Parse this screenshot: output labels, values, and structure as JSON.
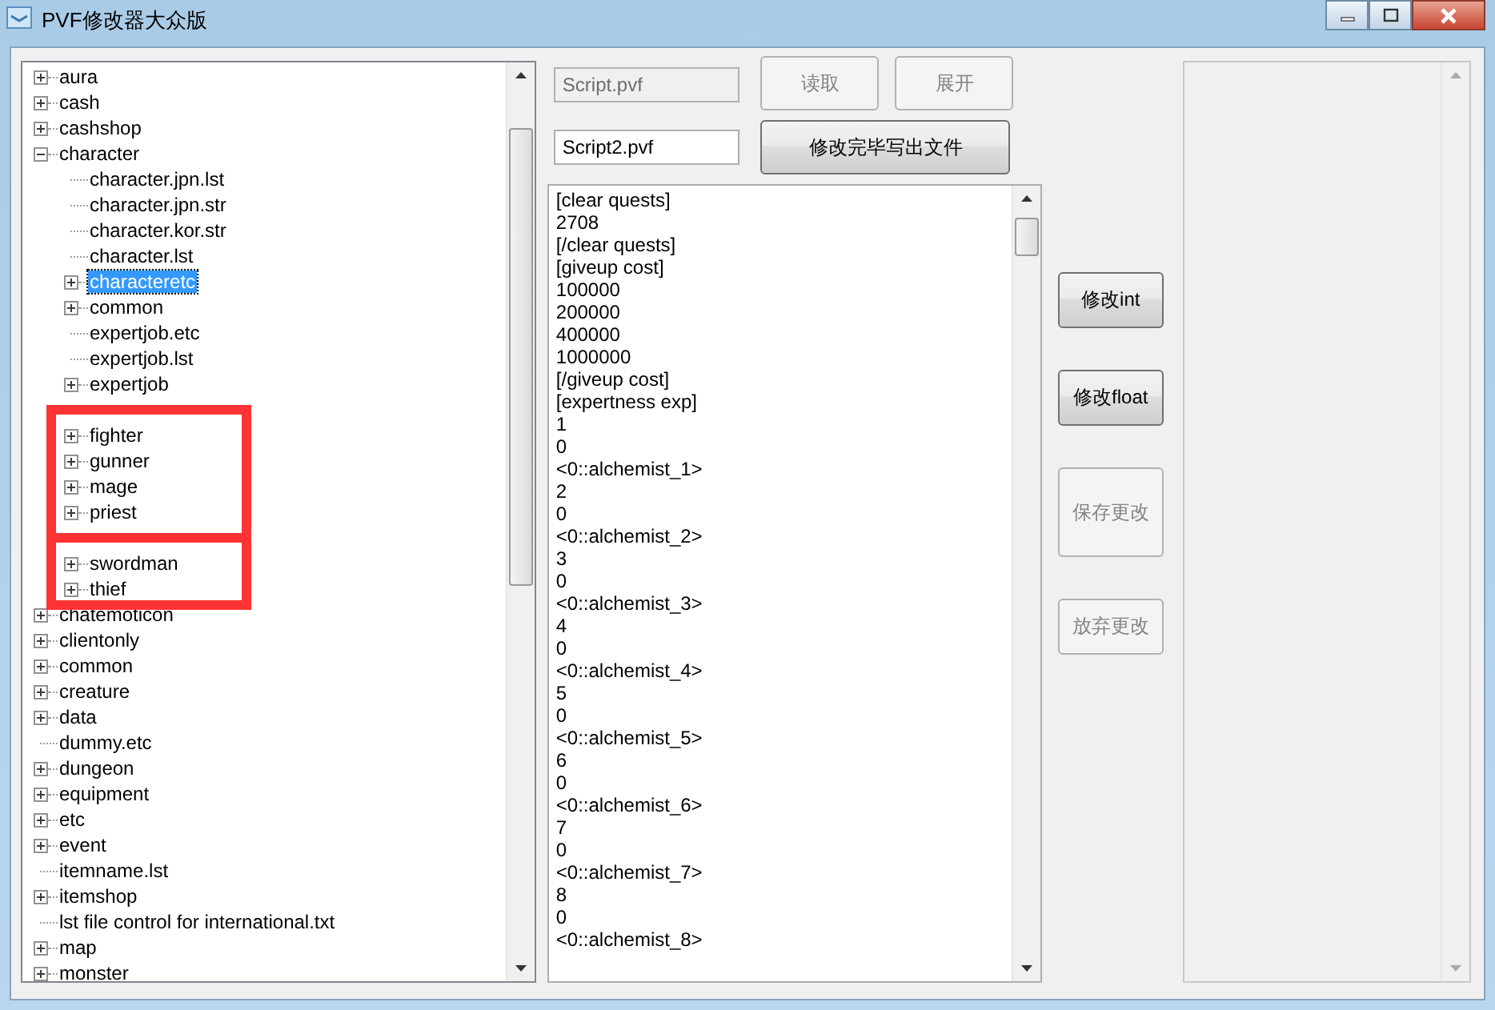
{
  "window": {
    "title": "PVF修改器大众版"
  },
  "tree": [
    {
      "label": "aura",
      "expanded": false,
      "selected": false
    },
    {
      "label": "cash",
      "expanded": false,
      "selected": false
    },
    {
      "label": "cashshop",
      "expanded": false,
      "selected": false
    },
    {
      "label": "character",
      "expanded": true,
      "selected": false,
      "children": [
        {
          "label": "character.jpn.lst",
          "selected": false
        },
        {
          "label": "character.jpn.str",
          "selected": false
        },
        {
          "label": "character.kor.str",
          "selected": false
        },
        {
          "label": "character.lst",
          "selected": false
        },
        {
          "label": "characteretc",
          "expanded": false,
          "selected": true
        },
        {
          "label": "common",
          "expanded": false,
          "selected": false
        },
        {
          "label": "expertjob.etc",
          "selected": false
        },
        {
          "label": "expertjob.lst",
          "selected": false
        },
        {
          "label": "expertjob",
          "expanded": false,
          "selected": false
        },
        {
          "kind": "covered"
        },
        {
          "label": "fighter",
          "expanded": false,
          "selected": false
        },
        {
          "label": "gunner",
          "expanded": false,
          "selected": false
        },
        {
          "label": "mage",
          "expanded": false,
          "selected": false
        },
        {
          "label": "priest",
          "expanded": false,
          "selected": false
        },
        {
          "kind": "covered"
        },
        {
          "label": "swordman",
          "expanded": false,
          "selected": false
        },
        {
          "label": "thief",
          "expanded": false,
          "selected": false
        }
      ]
    },
    {
      "label": "chatemoticon",
      "expanded": false,
      "selected": false
    },
    {
      "label": "clientonly",
      "expanded": false,
      "selected": false
    },
    {
      "label": "common",
      "expanded": false,
      "selected": false
    },
    {
      "label": "creature",
      "expanded": false,
      "selected": false
    },
    {
      "label": "data",
      "expanded": false,
      "selected": false
    },
    {
      "label": "dummy.etc",
      "selected": false
    },
    {
      "label": "dungeon",
      "expanded": false,
      "selected": false
    },
    {
      "label": "equipment",
      "expanded": false,
      "selected": false
    },
    {
      "label": "etc",
      "expanded": false,
      "selected": false
    },
    {
      "label": "event",
      "expanded": false,
      "selected": false
    },
    {
      "label": "itemname.lst",
      "selected": false
    },
    {
      "label": "itemshop",
      "expanded": false,
      "selected": false
    },
    {
      "label": "lst file control for international.txt",
      "selected": false
    },
    {
      "label": "map",
      "expanded": false,
      "selected": false
    },
    {
      "label": "monster",
      "expanded": false,
      "selected": false
    }
  ],
  "source_field": {
    "value": "Script.pvf",
    "disabled": true
  },
  "read_button": {
    "label": "读取",
    "disabled": true
  },
  "expand_button": {
    "label": "展开",
    "disabled": true
  },
  "output_field": {
    "value": "Script2.pvf",
    "disabled": false
  },
  "write_button": {
    "label": "修改完毕写出文件",
    "disabled": false
  },
  "editor_lines": [
    "[clear quests]",
    "2708",
    "[/clear quests]",
    "[giveup cost]",
    "100000",
    "200000",
    "400000",
    "1000000",
    "[/giveup cost]",
    "[expertness exp]",
    "1",
    "0",
    "<0::alchemist_1>",
    "2",
    "0",
    "<0::alchemist_2>",
    "3",
    "0",
    "<0::alchemist_3>",
    "4",
    "0",
    "<0::alchemist_4>",
    "5",
    "0",
    "<0::alchemist_5>",
    "6",
    "0",
    "<0::alchemist_6>",
    "7",
    "0",
    "<0::alchemist_7>",
    "8",
    "0",
    "<0::alchemist_8>"
  ],
  "side_buttons": [
    {
      "label": "修改int",
      "disabled": false,
      "kind": "short"
    },
    {
      "label": "修改float",
      "disabled": false,
      "kind": "short"
    },
    {
      "label": "保存更改",
      "disabled": true,
      "kind": "tall"
    },
    {
      "label": "放弃更改",
      "disabled": true,
      "kind": "short"
    }
  ]
}
